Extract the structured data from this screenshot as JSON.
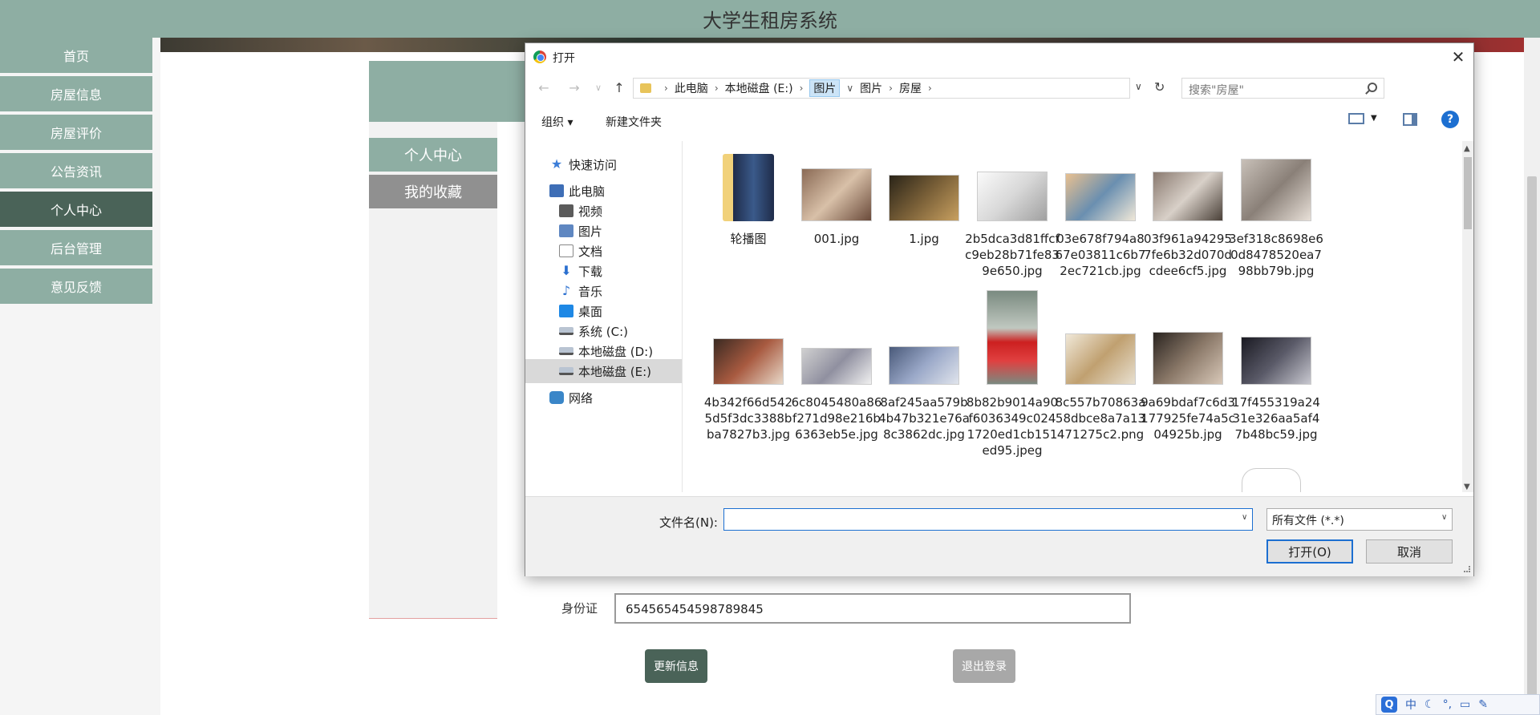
{
  "site": {
    "title": "大学生租房系统",
    "nav": [
      {
        "label": "首页"
      },
      {
        "label": "房屋信息"
      },
      {
        "label": "房屋评价"
      },
      {
        "label": "公告资讯"
      },
      {
        "label": "个人中心",
        "active": true
      },
      {
        "label": "后台管理"
      },
      {
        "label": "意见反馈"
      }
    ],
    "side_tabs": {
      "personal": "个人中心",
      "favorites": "我的收藏"
    },
    "id_label": "身份证",
    "id_value": "654565454598789845",
    "update_button": "更新信息",
    "logout_button": "退出登录",
    "colors": {
      "primary": "#8eaea3",
      "active": "#4a6358",
      "muted": "#a8a8a8"
    }
  },
  "ime": {
    "logo": "Q",
    "mode": "中",
    "icons": [
      "moon-icon",
      "punctuation-icon",
      "keyboard-icon",
      "tools-icon"
    ]
  },
  "dialog": {
    "title": "打开",
    "close_glyph": "✕",
    "breadcrumb": [
      "此电脑",
      "本地磁盘 (E:)",
      "图片",
      "图片",
      "房屋"
    ],
    "search_placeholder": "搜索\"房屋\"",
    "toolbar": {
      "organize": "组织",
      "new_folder": "新建文件夹",
      "help": "?"
    },
    "nav_items": [
      {
        "label": "快速访问",
        "icon": "star-icon"
      },
      {
        "label": "此电脑",
        "icon": "computer-icon"
      },
      {
        "label": "视频",
        "icon": "video-icon"
      },
      {
        "label": "图片",
        "icon": "pictures-icon"
      },
      {
        "label": "文档",
        "icon": "documents-icon"
      },
      {
        "label": "下载",
        "icon": "download-icon"
      },
      {
        "label": "音乐",
        "icon": "music-icon"
      },
      {
        "label": "桌面",
        "icon": "desktop-icon"
      },
      {
        "label": "系统 (C:)",
        "icon": "drive-icon"
      },
      {
        "label": "本地磁盘 (D:)",
        "icon": "drive-icon"
      },
      {
        "label": "本地磁盘 (E:)",
        "icon": "drive-icon",
        "selected": true
      },
      {
        "label": "网络",
        "icon": "network-icon"
      }
    ],
    "files": [
      {
        "name": "轮播图",
        "type": "folder"
      },
      {
        "name": "001.jpg",
        "type": "image"
      },
      {
        "name": "1.jpg",
        "type": "image"
      },
      {
        "name": "2b5dca3d81ffcfc9eb28b71fe839e650.jpg",
        "type": "image"
      },
      {
        "name": "03e678f794a867e03811c6b72ec721cb.jpg",
        "type": "image"
      },
      {
        "name": "03f961a942957fe6b32d070dcdee6cf5.jpg",
        "type": "image"
      },
      {
        "name": "3ef318c8698e60d8478520ea798bb79b.jpg",
        "type": "image"
      },
      {
        "name": "4b342f66d5425d5f3dc3388bba7827b3.jpg",
        "type": "image"
      },
      {
        "name": "6c8045480a86f271d98e216b6363eb5e.jpg",
        "type": "image"
      },
      {
        "name": "8af245aa579b4b47b321e76a8c3862dc.jpg",
        "type": "image"
      },
      {
        "name": "8b82b9014a90f6036349c0241720ed1cb151ed95.jpeg",
        "type": "image"
      },
      {
        "name": "8c557b70863a58dbce8a7a13471275c2.png",
        "type": "image"
      },
      {
        "name": "9a69bdaf7c6d3177925fe74a5c04925b.jpg",
        "type": "image"
      },
      {
        "name": "17f455319a2431e326aa5af47b48bc59.jpg",
        "type": "image"
      }
    ],
    "filename_label": "文件名(N):",
    "filename_value": "",
    "filetype": "所有文件 (*.*)",
    "open_button": "打开(O)",
    "cancel_button": "取消"
  }
}
